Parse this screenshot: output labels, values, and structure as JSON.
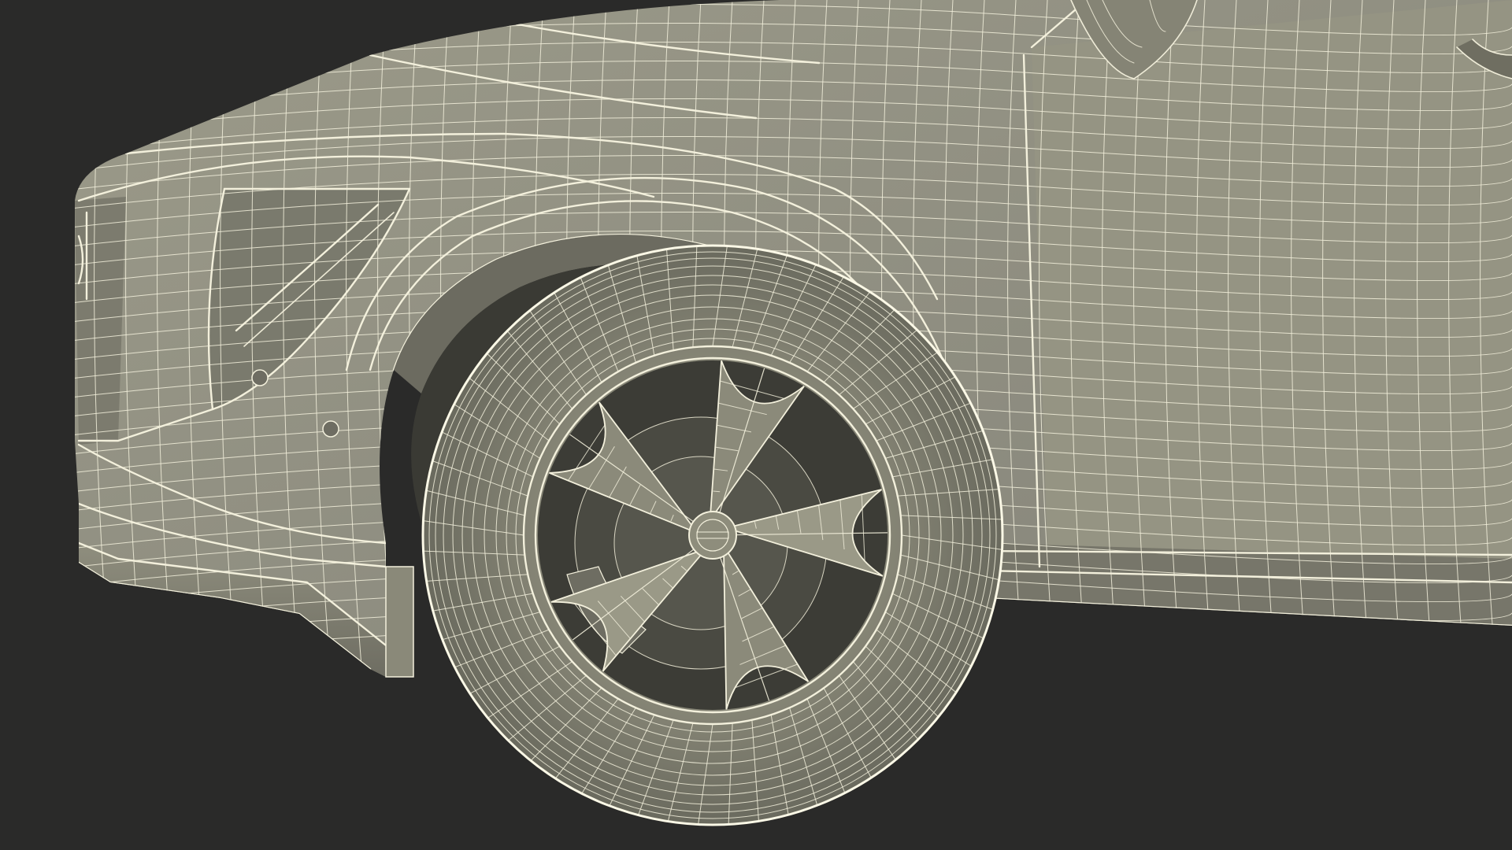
{
  "scene": {
    "subject": "car-front-wheel-wireframe",
    "colors": {
      "background": "#2a2a29",
      "body": "#8d8c7c",
      "body_light": "#9a9988",
      "body_dark": "#6f6e61",
      "shadow": "#55554b",
      "tire": "#7f7e70",
      "tire_dark": "#66665a",
      "cavity": "#3a3a34",
      "wire": "#f3f0dc"
    }
  }
}
